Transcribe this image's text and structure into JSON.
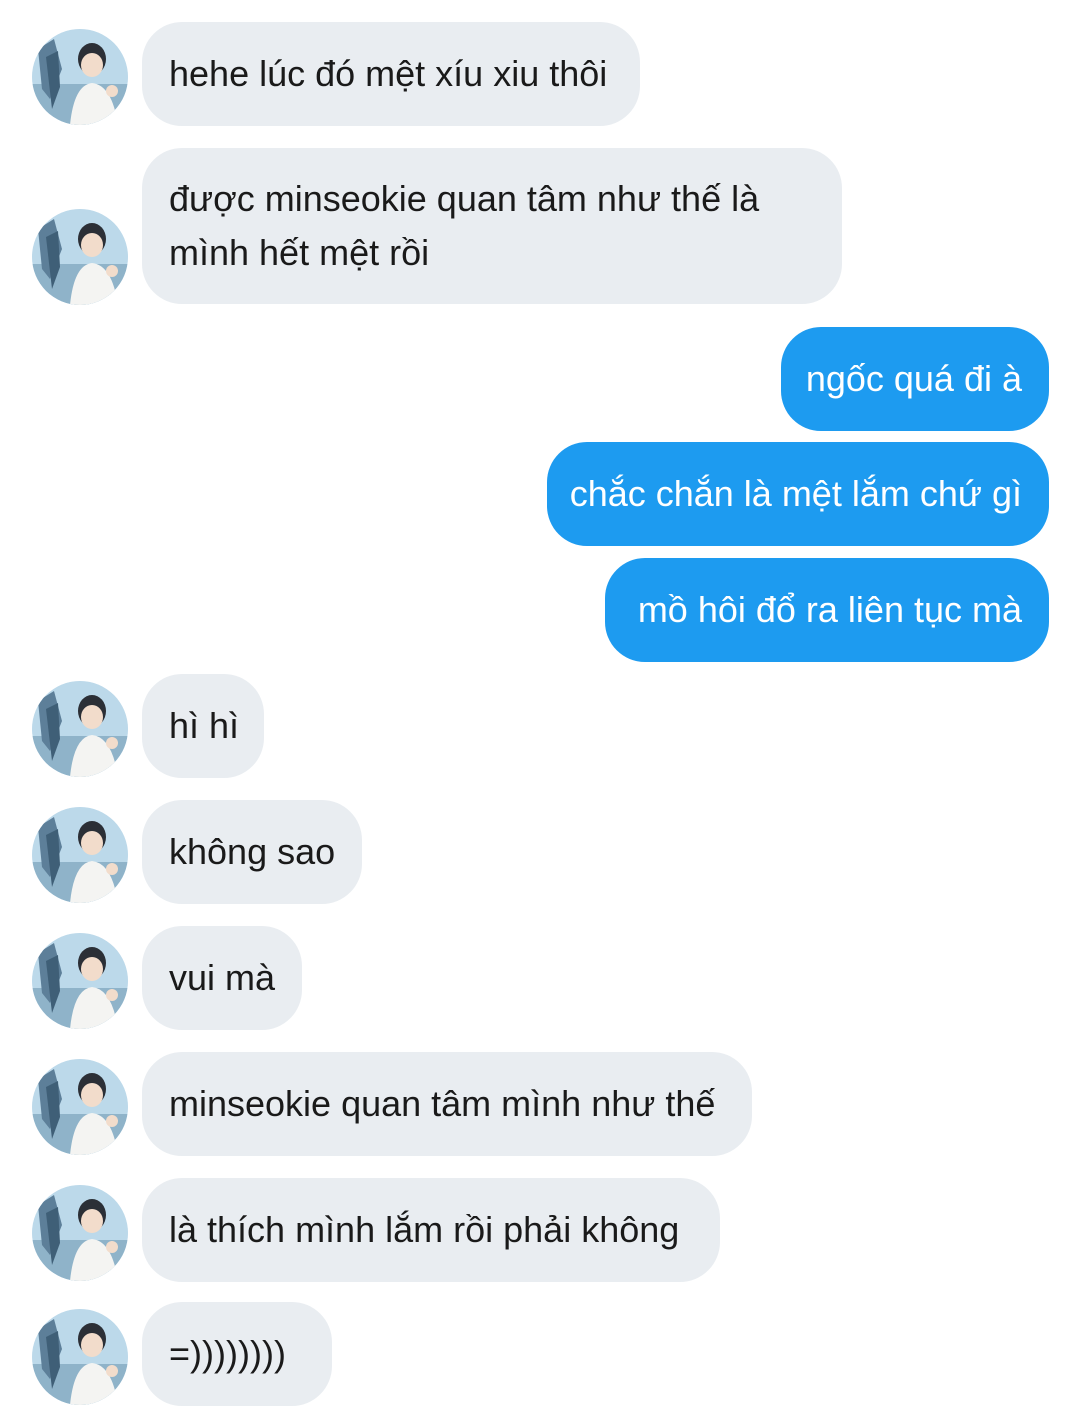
{
  "conversation": {
    "messages": [
      {
        "sender": "contact",
        "text": "hehe lúc đó mệt xíu xiu thôi"
      },
      {
        "sender": "contact",
        "text": "được minseokie quan tâm như thế là mình hết mệt rồi"
      },
      {
        "sender": "me",
        "text": "ngốc quá đi à"
      },
      {
        "sender": "me",
        "text": "chắc chắn là mệt lắm chứ gì"
      },
      {
        "sender": "me",
        "text": "mồ hôi đổ ra liên tục mà"
      },
      {
        "sender": "contact",
        "text": "hì hì"
      },
      {
        "sender": "contact",
        "text": "không sao"
      },
      {
        "sender": "contact",
        "text": "vui mà"
      },
      {
        "sender": "contact",
        "text": "minseokie quan tâm mình như thế"
      },
      {
        "sender": "contact",
        "text": "là thích mình lắm rồi phải không"
      },
      {
        "sender": "contact",
        "text": "=))))))))"
      }
    ]
  },
  "colors": {
    "incoming_bubble": "#e9edf1",
    "outgoing_bubble": "#1d9bf0",
    "incoming_text": "#1a1a1a",
    "outgoing_text": "#ffffff"
  },
  "icons": {
    "avatar": "contact-avatar-photo"
  }
}
